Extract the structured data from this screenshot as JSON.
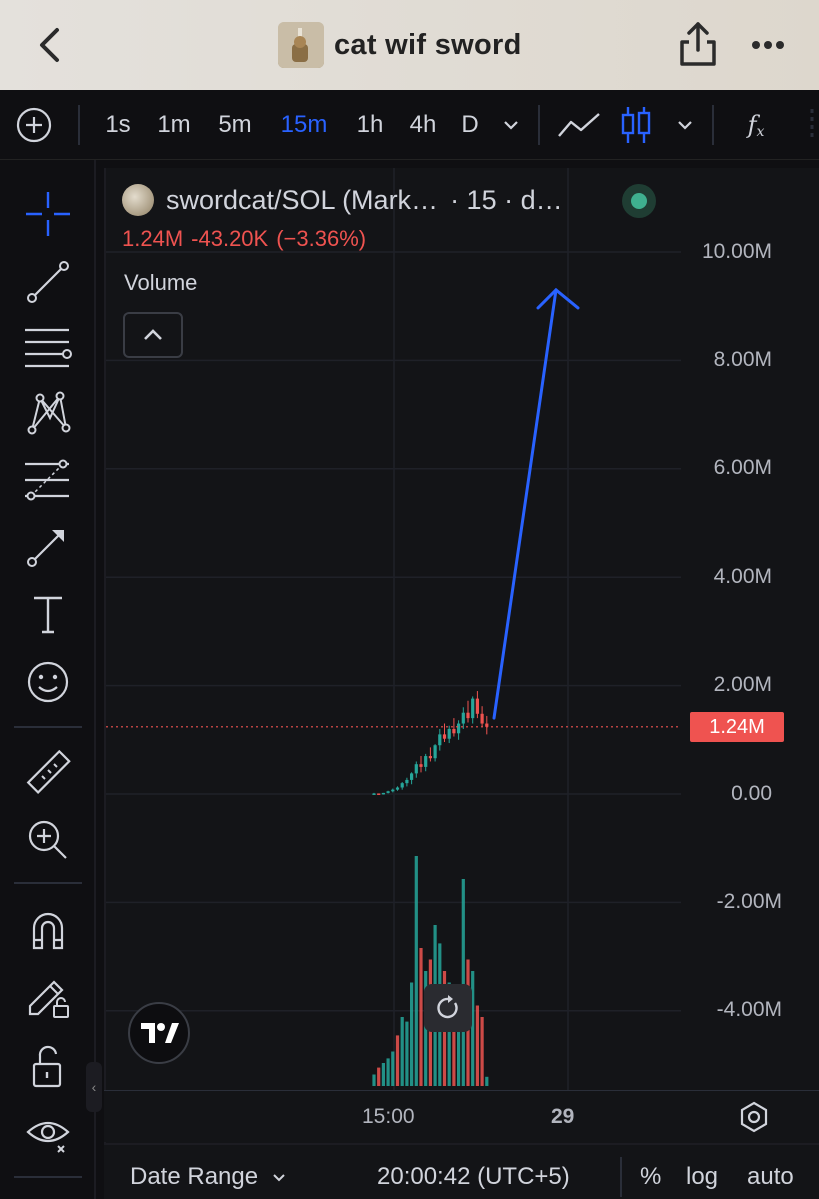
{
  "header": {
    "title": "cat wif sword",
    "back_icon": "chevron-left-icon",
    "share_icon": "share-icon",
    "more_icon": "ellipsis-icon"
  },
  "toolbar": {
    "intervals": [
      "1s",
      "1m",
      "5m",
      "15m",
      "1h",
      "4h",
      "D"
    ],
    "active_interval": "15m",
    "fx_label": "f"
  },
  "chart": {
    "symbol": "swordcat/SOL (Mark…",
    "interval_info": "· 15 · d…",
    "price": "1.24M",
    "change": "-43.20K",
    "change_pct": "(−3.36%)",
    "volume_label": "Volume",
    "y_axis": [
      "10.00M",
      "8.00M",
      "6.00M",
      "4.00M",
      "2.00M",
      "0.00",
      "-2.00M",
      "-4.00M"
    ],
    "last_price": "1.24M",
    "x_axis": [
      "15:00",
      "29"
    ],
    "colors": {
      "up": "#26a69a",
      "down": "#ef5350",
      "drawing": "#2962ff"
    }
  },
  "chart_data": {
    "type": "candlestick",
    "title": "",
    "ylim": [
      -5.0,
      10.5
    ],
    "y_unit": "M",
    "candles": [
      [
        0.01,
        0.02,
        0.0,
        0.01
      ],
      [
        0.01,
        0.01,
        -0.01,
        0.0
      ],
      [
        0.0,
        0.02,
        -0.01,
        0.02
      ],
      [
        0.02,
        0.06,
        0.01,
        0.05
      ],
      [
        0.05,
        0.1,
        0.03,
        0.08
      ],
      [
        0.08,
        0.14,
        0.06,
        0.12
      ],
      [
        0.12,
        0.22,
        0.08,
        0.2
      ],
      [
        0.2,
        0.3,
        0.14,
        0.26
      ],
      [
        0.26,
        0.4,
        0.18,
        0.38
      ],
      [
        0.38,
        0.6,
        0.3,
        0.55
      ],
      [
        0.55,
        0.7,
        0.4,
        0.5
      ],
      [
        0.5,
        0.74,
        0.42,
        0.7
      ],
      [
        0.7,
        0.86,
        0.6,
        0.66
      ],
      [
        0.66,
        0.92,
        0.6,
        0.9
      ],
      [
        0.9,
        1.2,
        0.8,
        1.1
      ],
      [
        1.1,
        1.3,
        0.96,
        1.02
      ],
      [
        1.02,
        1.26,
        0.94,
        1.2
      ],
      [
        1.2,
        1.4,
        1.06,
        1.12
      ],
      [
        1.12,
        1.36,
        1.0,
        1.3
      ],
      [
        1.3,
        1.6,
        1.2,
        1.5
      ],
      [
        1.5,
        1.72,
        1.32,
        1.4
      ],
      [
        1.4,
        1.8,
        1.3,
        1.76
      ],
      [
        1.76,
        1.9,
        1.4,
        1.48
      ],
      [
        1.48,
        1.62,
        1.24,
        1.3
      ],
      [
        1.3,
        1.44,
        1.1,
        1.24
      ]
    ],
    "volume": [
      0.05,
      0.08,
      0.1,
      0.12,
      0.15,
      0.22,
      0.3,
      0.28,
      0.45,
      1.0,
      0.6,
      0.5,
      0.55,
      0.7,
      0.62,
      0.5,
      0.45,
      0.4,
      0.38,
      0.9,
      0.55,
      0.5,
      0.35,
      0.3,
      0.04
    ],
    "volume_direction": [
      "u",
      "d",
      "u",
      "u",
      "u",
      "d",
      "u",
      "u",
      "u",
      "u",
      "d",
      "u",
      "d",
      "u",
      "u",
      "d",
      "u",
      "d",
      "u",
      "u",
      "d",
      "u",
      "d",
      "d",
      "u"
    ]
  },
  "time_axis": {
    "settings_icon": "gear-icon"
  },
  "bottombar": {
    "date_range": "Date Range",
    "clock": "20:00:42 (UTC+5)",
    "percent": "%",
    "log": "log",
    "auto": "auto"
  }
}
